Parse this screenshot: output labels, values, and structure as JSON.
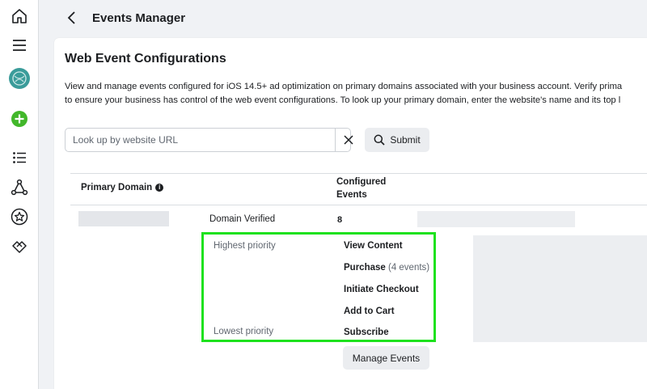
{
  "rail": {
    "icons": [
      "home-icon",
      "menu-icon",
      "account-avatar",
      "create-icon",
      "list-icon",
      "network-icon",
      "star-icon",
      "partnership-icon"
    ],
    "accent": "#42b72a"
  },
  "topbar": {
    "title": "Events Manager"
  },
  "card": {
    "title": "Web Event Configurations",
    "desc_line1": "View and manage events configured for iOS 14.5+ ad optimization on primary domains associated with your business account. Verify prima",
    "desc_line2": "to ensure your business has control of the web event configurations. To look up your primary domain, enter the website's name and its top l"
  },
  "search": {
    "placeholder": "Look up by website URL",
    "value": "",
    "submit_label": "Submit"
  },
  "table": {
    "header_domain": "Primary Domain",
    "header_events_line1": "Configured",
    "header_events_line2": "Events",
    "row": {
      "status": "Domain Verified",
      "events_count": "8"
    }
  },
  "priority": {
    "highest_label": "Highest priority",
    "lowest_label": "Lowest priority",
    "events": [
      {
        "name": "View Content",
        "note": ""
      },
      {
        "name": "Purchase",
        "note": "(4 events)"
      },
      {
        "name": "Initiate Checkout",
        "note": ""
      },
      {
        "name": "Add to Cart",
        "note": ""
      },
      {
        "name": "Subscribe",
        "note": ""
      }
    ],
    "highlight_color": "#1ee21e"
  },
  "manage_button": "Manage Events"
}
